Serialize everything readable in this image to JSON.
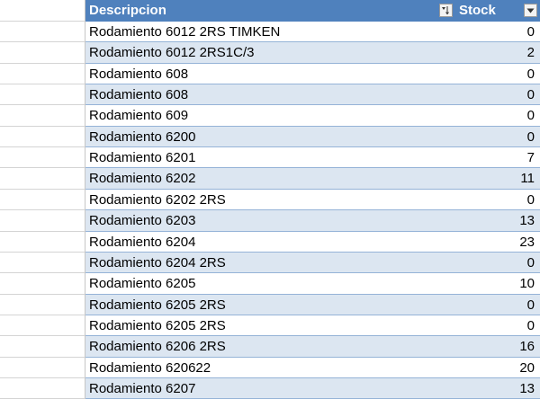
{
  "table": {
    "columns": {
      "descripcion": "Descripcion",
      "stock": "Stock"
    },
    "rows": [
      {
        "descripcion": "Rodamiento 6012 2RS TIMKEN",
        "stock": "0"
      },
      {
        "descripcion": "Rodamiento 6012 2RS1C/3",
        "stock": "2"
      },
      {
        "descripcion": "Rodamiento 608",
        "stock": "0"
      },
      {
        "descripcion": "Rodamiento 608",
        "stock": "0"
      },
      {
        "descripcion": "Rodamiento 609",
        "stock": "0"
      },
      {
        "descripcion": "Rodamiento 6200",
        "stock": "0"
      },
      {
        "descripcion": "Rodamiento 6201",
        "stock": "7"
      },
      {
        "descripcion": "Rodamiento 6202",
        "stock": "11"
      },
      {
        "descripcion": "Rodamiento 6202 2RS",
        "stock": "0"
      },
      {
        "descripcion": "Rodamiento 6203",
        "stock": "13"
      },
      {
        "descripcion": "Rodamiento 6204",
        "stock": "23"
      },
      {
        "descripcion": "Rodamiento 6204 2RS",
        "stock": "0"
      },
      {
        "descripcion": "Rodamiento 6205",
        "stock": "10"
      },
      {
        "descripcion": "Rodamiento 6205 2RS",
        "stock": "0"
      },
      {
        "descripcion": "Rodamiento 6205 2RS",
        "stock": "0"
      },
      {
        "descripcion": "Rodamiento 6206 2RS",
        "stock": "16"
      },
      {
        "descripcion": "Rodamiento 620622",
        "stock": "20"
      },
      {
        "descripcion": "Rodamiento 6207",
        "stock": "13"
      }
    ]
  },
  "icons": {
    "descripcion_filter": "sort-filter-icon",
    "stock_filter": "filter-dropdown-icon"
  },
  "colors": {
    "header": "#4f81bd",
    "band": "#dce6f1",
    "border": "#95b3d7"
  }
}
